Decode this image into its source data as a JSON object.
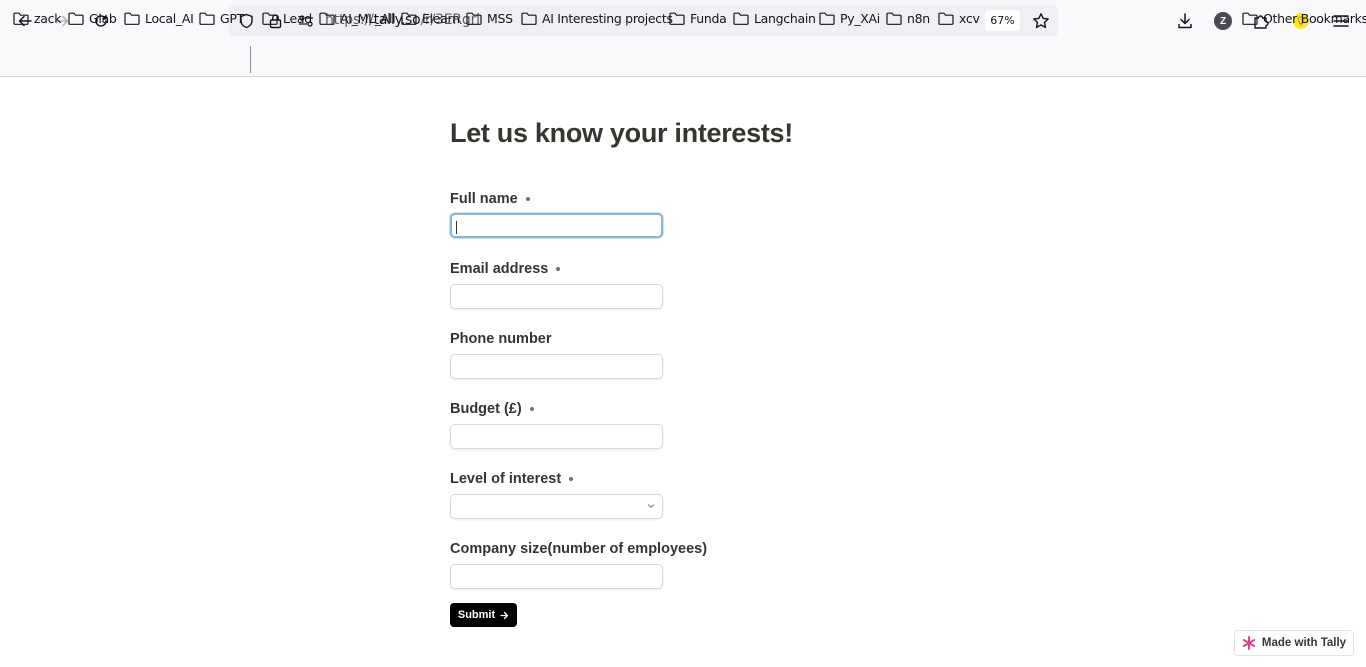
{
  "browser": {
    "url_prefix": "https://",
    "url_host": "tally.so",
    "url_path": "/r/3ERgrl",
    "zoom": "67%",
    "profile_initial": "Z"
  },
  "bookmarks": {
    "items": [
      "zack",
      "Glab",
      "Local_AI",
      "GPT",
      "Lead",
      "AI_ML_All",
      "Elearn",
      "MSS",
      "AI Interesting projects",
      "Funda",
      "Langchain",
      "Py_XAi",
      "n8n",
      "xcv"
    ],
    "other": "Other Bookmarks"
  },
  "form": {
    "title": "Let us know your interests!",
    "fields": [
      {
        "label": "Full name",
        "required": true,
        "value": ""
      },
      {
        "label": "Email address",
        "required": true,
        "value": ""
      },
      {
        "label": "Phone number",
        "required": false,
        "value": ""
      },
      {
        "label": "Budget (£)",
        "required": true,
        "value": ""
      },
      {
        "label": "Level of interest",
        "required": true,
        "value": ""
      },
      {
        "label": "Company size(number of employees)",
        "required": false,
        "value": ""
      }
    ],
    "submit_label": "Submit"
  },
  "badge": {
    "label": "Made with Tally"
  },
  "colors": {
    "accent": "#000000",
    "focus": "#8ab4d8",
    "tally_logo": "#e83e8c"
  }
}
